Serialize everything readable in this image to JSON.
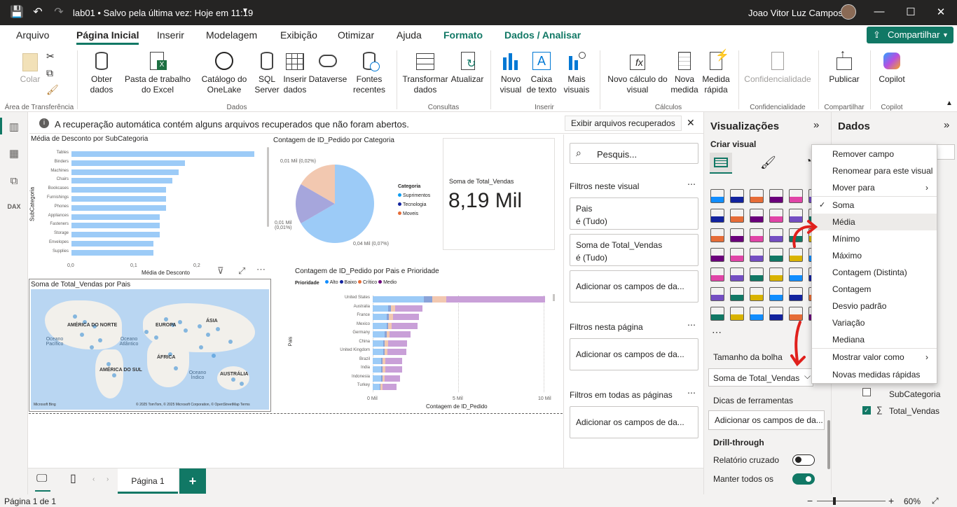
{
  "titlebar": {
    "title": "lab01 • Salvo pela última vez: Hoje em 11:19",
    "user": "Joao Vitor Luz Campos"
  },
  "menu": {
    "tabs": [
      "Arquivo",
      "Página Inicial",
      "Inserir",
      "Modelagem",
      "Exibição",
      "Otimizar",
      "Ajuda",
      "Formato",
      "Dados / Analisar"
    ],
    "share": "Compartilhar"
  },
  "ribbon": {
    "colar": "Colar",
    "obter": "Obter dados",
    "excel": "Pasta de trabalho do Excel",
    "onelake": "Catálogo do OneLake",
    "sql": "SQL Server",
    "inserir_dados": "Inserir dados",
    "dataverse": "Dataverse",
    "fontes": "Fontes recentes",
    "transformar": "Transformar dados",
    "atualizar": "Atualizar",
    "novo_visual": "Novo visual",
    "caixa_texto": "Caixa de texto",
    "mais_visuais": "Mais visuais",
    "novo_calculo": "Novo cálculo do visual",
    "nova_medida": "Nova medida",
    "medida_rapida": "Medida rápida",
    "confidencialidade": "Confidencialidade",
    "publicar": "Publicar",
    "copilot": "Copilot",
    "groups": {
      "transfer": "Área de Transferência",
      "dados": "Dados",
      "consultas": "Consultas",
      "inserir": "Inserir",
      "calculos": "Cálculos",
      "confid": "Confidencialidade",
      "compartilhar": "Compartilhar",
      "copilot": "Copilot"
    }
  },
  "infobar": {
    "message": "A recuperação automática contém alguns arquivos recuperados que não foram abertos.",
    "button": "Exibir arquivos recuperados"
  },
  "visual1": {
    "title": "Média de Desconto por SubCategoria",
    "ylabel": "SubCategoria",
    "xlabel": "Média de Desconto",
    "ticks": [
      "0,0",
      "0,1",
      "0,2"
    ]
  },
  "visual2": {
    "title": "Contagem de ID_Pedido por Categoria",
    "legend_title": "Categoria",
    "legend": [
      "Suprimentos",
      "Tecnologia",
      "Moveis"
    ],
    "labels": [
      "0,01 Mil (0,02%)",
      "0,01 Mil (0,01%)",
      "0,04 Mil (0,07%)"
    ]
  },
  "card": {
    "label": "Soma de Total_Vendas",
    "value": "8,19 Mil"
  },
  "map": {
    "title": "Soma de Total_Vendas por Pais",
    "regions": [
      "AMÉRICA DO NORTE",
      "EUROPA",
      "ÁSIA",
      "Oceano Pacífico",
      "Oceano Atlântico",
      "ÁFRICA",
      "AMÉRICA DO SUL",
      "Oceano Índico",
      "AUSTRÁLIA"
    ],
    "footer": "© 2025 TomTom, © 2025 Microsoft Corporation, © OpenStreetMap  Terms",
    "brand": "Microsoft Bing"
  },
  "visual4": {
    "title": "Contagem de ID_Pedido por Pais e Prioridade",
    "legend_title": "Prioridade",
    "legend": [
      "Alto",
      "Baixo",
      "Crítico",
      "Medio"
    ],
    "ylabel": "Pais",
    "xlabel": "Contagem de ID_Pedido",
    "ticks": [
      "0 Mil",
      "5 Mil",
      "10 Mil"
    ]
  },
  "filters": {
    "search": "Pesquis...",
    "sec1": "Filtros neste visual",
    "f1_name": "Pais",
    "f1_val": "é (Tudo)",
    "f2_name": "Soma de Total_Vendas",
    "f2_val": "é (Tudo)",
    "add": "Adicionar os campos de da...",
    "sec2": "Filtros nesta página",
    "sec3": "Filtros em todas as páginas"
  },
  "viz": {
    "title": "Visualizações",
    "criar": "Criar visual",
    "bolha": "Tamanho da bolha",
    "field": "Soma de Total_Vendas",
    "dicas": "Dicas de ferramentas",
    "add": "Adicionar os campos de da...",
    "drill": "Drill-through",
    "relatorio": "Relatório cruzado",
    "manter": "Manter todos os"
  },
  "data": {
    "title": "Dados",
    "fields": [
      "SubCategoria",
      "Total_Vendas"
    ]
  },
  "contextmenu": {
    "items": [
      "Remover campo",
      "Renomear para este visual",
      "Mover para",
      "Soma",
      "Média",
      "Mínimo",
      "Máximo",
      "Contagem (Distinta)",
      "Contagem",
      "Desvio padrão",
      "Variação",
      "Mediana",
      "Mostrar valor como",
      "Novas medidas rápidas"
    ]
  },
  "pages": {
    "tab": "Página 1"
  },
  "status": {
    "page": "Página 1 de 1",
    "zoom": "60%"
  },
  "chart_data": [
    {
      "type": "bar",
      "title": "Média de Desconto por SubCategoria",
      "categories": [
        "Tables",
        "Binders",
        "Machines",
        "Chairs",
        "Bookcases",
        "Furnishings",
        "Phones",
        "Appliances",
        "Fasteners",
        "Storage",
        "Envelopes",
        "Supplies"
      ],
      "values": [
        0.29,
        0.18,
        0.17,
        0.16,
        0.15,
        0.15,
        0.15,
        0.14,
        0.14,
        0.14,
        0.13,
        0.13
      ],
      "xlabel": "Média de Desconto",
      "ylabel": "SubCategoria",
      "xlim": [
        0,
        0.3
      ]
    },
    {
      "type": "pie",
      "title": "Contagem de ID_Pedido por Categoria",
      "categories": [
        "Suprimentos",
        "Tecnologia",
        "Moveis"
      ],
      "values": [
        0.04,
        0.01,
        0.01
      ]
    },
    {
      "type": "bar",
      "title": "Contagem de ID_Pedido por Pais e Prioridade",
      "categories": [
        "United States",
        "Australia",
        "France",
        "Mexico",
        "Germany",
        "China",
        "United Kingdom",
        "Brazil",
        "India",
        "Indonesia",
        "Turkey"
      ],
      "series": [
        {
          "name": "Alto",
          "values": [
            3.0,
            0.9,
            0.8,
            0.8,
            0.7,
            0.6,
            0.6,
            0.5,
            0.5,
            0.5,
            0.4
          ]
        },
        {
          "name": "Baixo",
          "values": [
            0.5,
            0.15,
            0.15,
            0.12,
            0.1,
            0.1,
            0.1,
            0.08,
            0.08,
            0.08,
            0.06
          ]
        },
        {
          "name": "Crítico",
          "values": [
            0.8,
            0.25,
            0.25,
            0.2,
            0.2,
            0.2,
            0.15,
            0.15,
            0.15,
            0.12,
            0.12
          ]
        },
        {
          "name": "Medio",
          "values": [
            5.8,
            1.6,
            1.5,
            1.5,
            1.2,
            1.1,
            1.1,
            1.0,
            1.0,
            0.9,
            0.8
          ]
        }
      ],
      "xlabel": "Contagem de ID_Pedido",
      "ylabel": "Pais",
      "xlim": [
        0,
        10
      ]
    }
  ],
  "colors": {
    "accent": "#117865",
    "bar": "#9ccbf7",
    "pie1": "#9ccbf7",
    "pie2": "#a6a6dc",
    "pie3": "#f2c8b0",
    "medio": "#c9a0d8"
  }
}
